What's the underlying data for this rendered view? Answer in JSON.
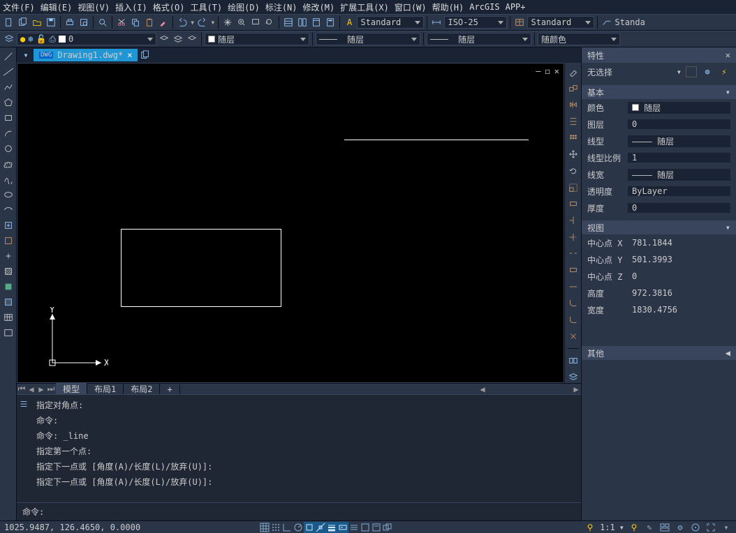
{
  "menu": [
    "文件(F)",
    "编辑(E)",
    "视图(V)",
    "插入(I)",
    "格式(O)",
    "工具(T)",
    "绘图(D)",
    "标注(N)",
    "修改(M)",
    "扩展工具(X)",
    "窗口(W)",
    "帮助(H)",
    "ArcGIS",
    "APP+"
  ],
  "layer": {
    "current": "0"
  },
  "style_combo1": "Standard",
  "style_combo2": "ISO-25",
  "style_combo3": "Standard",
  "style_combo4": "Standa",
  "prop_layer": "随层",
  "prop_linetype": "随层",
  "prop_lineweight": "随层",
  "prop_color": "随颜色",
  "file_tab": "Drawing1.dwg*",
  "model_tabs": {
    "model": "模型",
    "layout1": "布局1",
    "layout2": "布局2",
    "plus": "+"
  },
  "properties": {
    "title": "特性",
    "selection": "无选择",
    "groups": {
      "basic": {
        "title": "基本",
        "rows": [
          {
            "lbl": "颜色",
            "val": "随层",
            "swatch": true
          },
          {
            "lbl": "图层",
            "val": "0"
          },
          {
            "lbl": "线型",
            "val": "———— 随层"
          },
          {
            "lbl": "线型比例",
            "val": "1"
          },
          {
            "lbl": "线宽",
            "val": "———— 随层"
          },
          {
            "lbl": "透明度",
            "val": "ByLayer"
          },
          {
            "lbl": "厚度",
            "val": "0"
          }
        ]
      },
      "view": {
        "title": "视图",
        "rows": [
          {
            "lbl": "中心点 X",
            "val": "781.1844",
            "ro": true
          },
          {
            "lbl": "中心点 Y",
            "val": "501.3993",
            "ro": true
          },
          {
            "lbl": "中心点 Z",
            "val": "0",
            "ro": true
          },
          {
            "lbl": "高度",
            "val": "972.3816",
            "ro": true
          },
          {
            "lbl": "宽度",
            "val": "1830.4756",
            "ro": true
          }
        ]
      },
      "misc": {
        "title": "其他"
      }
    }
  },
  "cmd_log": [
    "指定对角点:",
    "命令:",
    "命令: _line",
    "指定第一个点:",
    "指定下一点或 [角度(A)/长度(L)/放弃(U)]:",
    "指定下一点或 [角度(A)/长度(L)/放弃(U)]:"
  ],
  "cmd_prompt": "命令: ",
  "status": {
    "coords": "1025.9487, 126.4650, 0.0000",
    "scale": "1:1"
  }
}
